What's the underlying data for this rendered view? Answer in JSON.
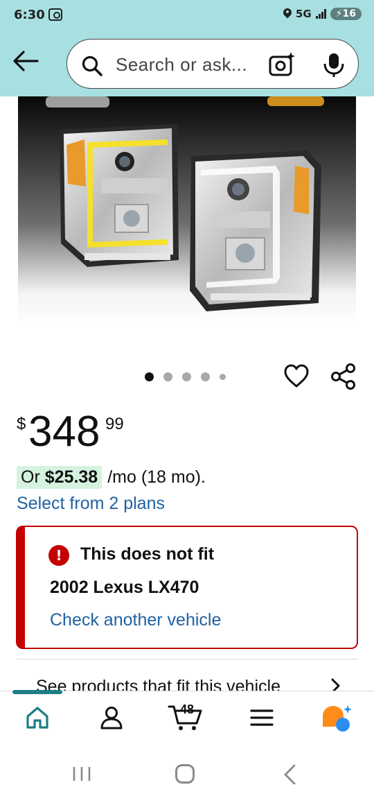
{
  "status_bar": {
    "time": "6:30",
    "network": "5G",
    "battery": "16"
  },
  "header": {
    "search_placeholder": "Search or ask...",
    "background_color": "#a8e0e2"
  },
  "product": {
    "image_alt": "Pair of chrome projector headlights with yellow LED light bars",
    "carousel": {
      "total": 5,
      "current": 1
    }
  },
  "price": {
    "symbol": "$",
    "whole": "348",
    "fraction": "99"
  },
  "installment": {
    "prefix": "Or",
    "amount": "$25.38",
    "suffix": "/mo (18 mo).",
    "plans_link": "Select from 2 plans"
  },
  "fit_alert": {
    "title": "This does not fit",
    "vehicle": "2002 Lexus LX470",
    "link": "Check another vehicle",
    "color": "#c40000"
  },
  "see_products": {
    "label": "See products that fit this vehicle"
  },
  "bottom_nav": {
    "items": [
      "home-icon",
      "account-icon",
      "cart-icon",
      "menu-icon",
      "rufus-icon"
    ],
    "cart_count": "48",
    "accent_color": "#1b7f85"
  },
  "link_color": "#2162a1"
}
